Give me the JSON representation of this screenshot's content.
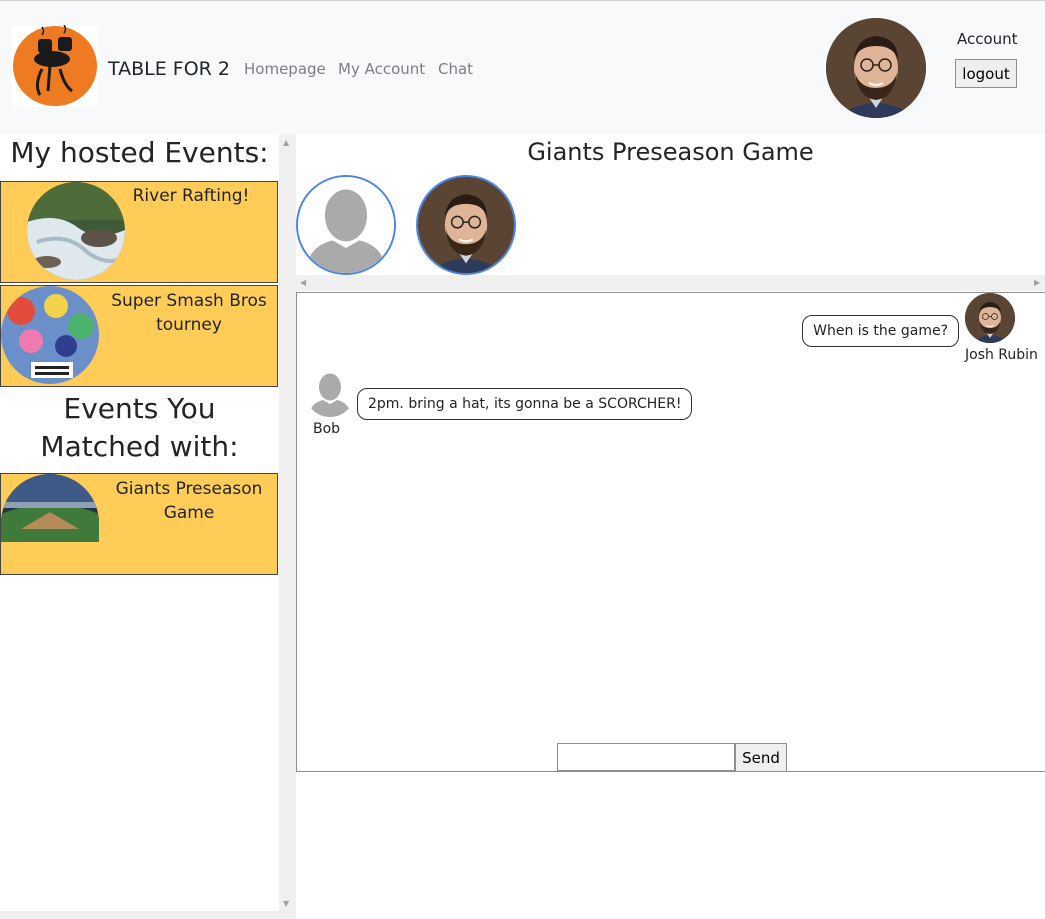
{
  "navbar": {
    "brand": "TABLE FOR 2",
    "links": [
      "Homepage",
      "My Account",
      "Chat"
    ],
    "account_label": "Account",
    "logout_label": "logout"
  },
  "sidebar": {
    "hosted_heading": "My hosted Events:",
    "matched_heading": "Events You Matched with:",
    "hosted_events": [
      "River Rafting!",
      "Super Smash Bros tourney"
    ],
    "matched_events": [
      "Giants Preseason Game"
    ]
  },
  "chat": {
    "title": "Giants Preseason Game",
    "messages": [
      {
        "author": "Josh Rubin",
        "text": "When is the game?"
      },
      {
        "author": "Bob",
        "text": "2pm. bring a hat, its gonna be a SCORCHER!"
      }
    ],
    "input_value": "",
    "send_label": "Send"
  },
  "colors": {
    "card": "#ffcd57",
    "navbar": "#f8f9fa",
    "participant_ring": "#4a86e8"
  }
}
